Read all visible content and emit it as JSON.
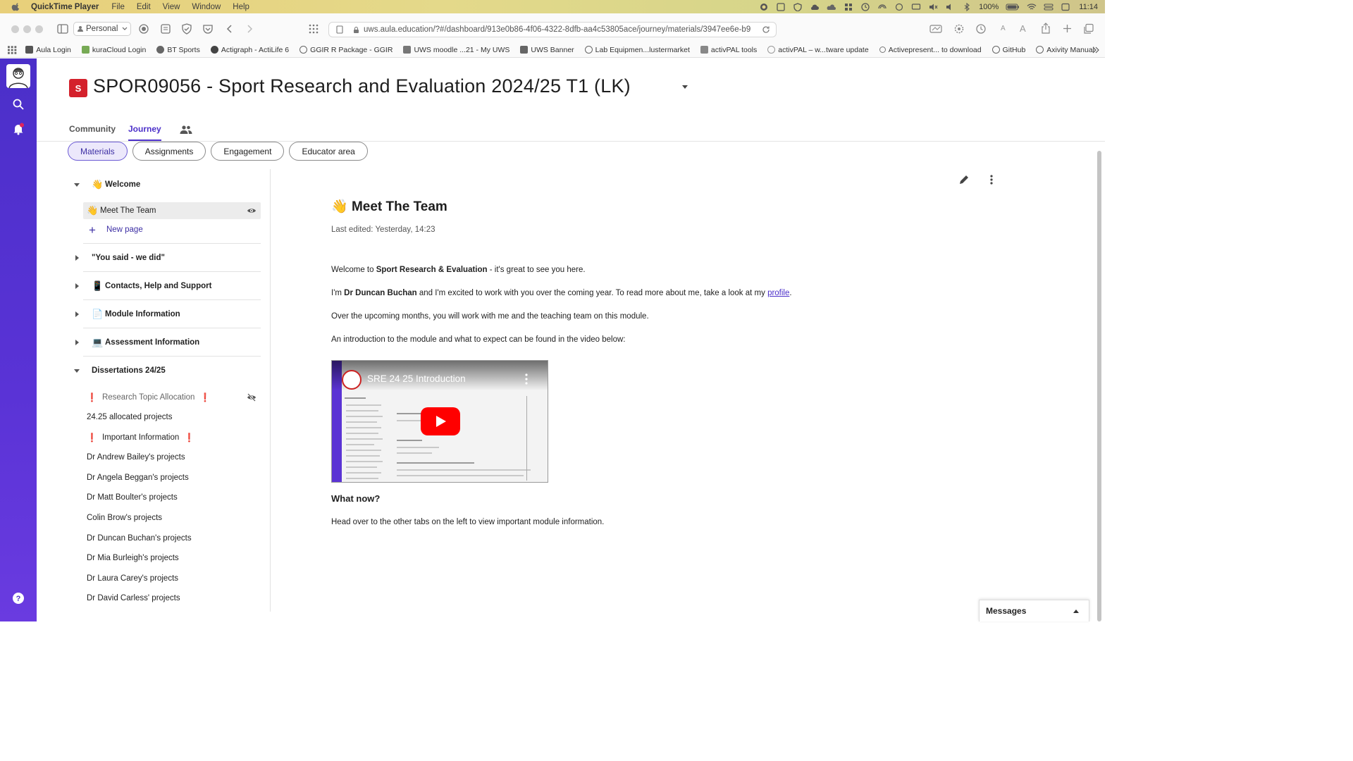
{
  "menubar": {
    "app_name": "QuickTime Player",
    "menus": [
      "File",
      "Edit",
      "View",
      "Window",
      "Help"
    ],
    "battery": "100%",
    "time": "11:14"
  },
  "browser": {
    "profile": "Personal",
    "url": "uws.aula.education/?#/dashboard/913e0b86-4f06-4322-8dfb-aa4c53805ace/journey/materials/3947ee6e-b9",
    "bookmarks": [
      "Aula Login",
      "kuraCloud Login",
      "BT Sports",
      "Actigraph - ActiLife 6",
      "GGIR R Package - GGIR",
      "UWS moodle ...21 - My UWS",
      "UWS Banner",
      "Lab Equipmen...lustermarket",
      "activPAL tools",
      "activPAL – w...tware update",
      "Activepresent... to download",
      "GitHub",
      "Axivity Manual"
    ]
  },
  "course": {
    "badge": "S",
    "title": "SPOR09056 - Sport Research and Evaluation 2024/25 T1 (LK)"
  },
  "tabs": {
    "community": "Community",
    "journey": "Journey"
  },
  "subtabs": [
    "Materials",
    "Assignments",
    "Engagement",
    "Educator area"
  ],
  "sidebar": {
    "welcome": {
      "emoji": "👋",
      "label": "Welcome"
    },
    "meet_team": {
      "emoji": "👋",
      "label": "Meet The Team"
    },
    "new_page": "New page",
    "you_said": "\"You said - we did\"",
    "contacts": {
      "emoji": "📱",
      "label": "Contacts, Help and Support"
    },
    "module_info": {
      "emoji": "📄",
      "label": "Module Information"
    },
    "assessment": {
      "emoji": "💻",
      "label": "Assessment Information"
    },
    "dissertations": "Dissertations 24/25",
    "items": {
      "research_topic": "Research Topic Allocation",
      "allocated": "24.25 allocated projects",
      "important": "Important Information",
      "bailey": "Dr Andrew Bailey's projects",
      "beggan": "Dr Angela Beggan's projects",
      "boulter": "Dr Matt Boulter's projects",
      "brow": "Colin Brow's projects",
      "buchan": "Dr Duncan Buchan's projects",
      "burleigh": "Dr Mia Burleigh's projects",
      "carey": "Dr Laura Carey's projects",
      "carless": "Dr David Carless' projects"
    },
    "bang": "❗"
  },
  "page": {
    "emoji": "👋",
    "title": "Meet The Team",
    "last_edited": "Last edited: Yesterday, 14:23",
    "p1_a": "Welcome to ",
    "p1_b": "Sport Research & Evaluation",
    "p1_c": " - it's great to see you here.",
    "p2_a": "I'm ",
    "p2_b": "Dr Duncan Buchan",
    "p2_c": " and I'm excited to work with you over the coming year. To read more about me, take a look at my ",
    "p2_link": "profile",
    "p2_d": ".",
    "p3": "Over the upcoming months, you will work with me and the teaching team on this module.",
    "p4": "An introduction to the module and what to expect can be found in the video below:",
    "video_title": "SRE 24 25 Introduction",
    "what_now": "What now?",
    "p5": "Head over to the other tabs on the left to view important module information."
  },
  "messages": "Messages",
  "colors": {
    "accent": "#4b2fc9",
    "badge_red": "#d4212c",
    "active_pill_bg": "#ece8fb"
  }
}
